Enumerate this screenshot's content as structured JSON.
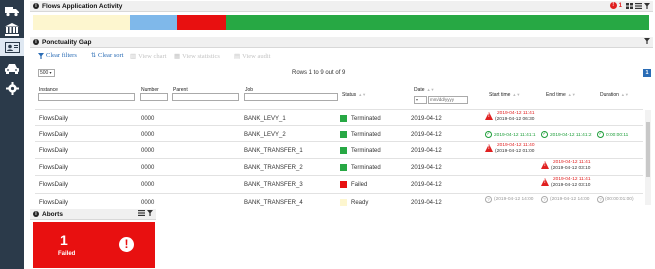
{
  "sidebar": {
    "items": [
      {
        "icon": "truck-icon"
      },
      {
        "icon": "bank-icon"
      },
      {
        "icon": "id-card-icon"
      },
      {
        "icon": "car-icon"
      },
      {
        "icon": "gear-icon"
      }
    ]
  },
  "flows_panel": {
    "title": "Flows Application Activity",
    "alert_count": "1",
    "segments": [
      {
        "color": "#fdf6cf",
        "fraction": 0.158
      },
      {
        "color": "#7fb8ea",
        "fraction": 0.076
      },
      {
        "color": "#e81010",
        "fraction": 0.08
      },
      {
        "color": "#27a844",
        "fraction": 0.686
      }
    ]
  },
  "gap_panel": {
    "title": "Ponctuality Gap",
    "toolbar": {
      "clear_filters": "Clear filters",
      "clear_sort": "Clear sort",
      "view_chart": "View chart",
      "view_statistics": "View statistics",
      "view_audit": "View audit"
    },
    "page_size": "500",
    "rows_info": "Rows 1 to 9 out of 9",
    "page_number": "1",
    "columns": {
      "instance": "Instance",
      "number": "Number",
      "parent": "Parent",
      "job": "Job",
      "status": "Status",
      "date": "Date",
      "start_time": "Start time",
      "end_time": "End time",
      "duration": "Duration"
    },
    "date_placeholder": "mm/dd/yyyy",
    "rows": [
      {
        "instance": "FlowsDaily",
        "number": "0000",
        "job": "BANK_LEVY_1",
        "status": "Terminated",
        "status_color": "#27a844",
        "date": "2019-04-12",
        "start_top": "2019-04-12 11:41",
        "start_bottom": "(2019-04-12 06:30"
      },
      {
        "instance": "FlowsDaily",
        "number": "0000",
        "job": "BANK_LEVY_2",
        "status": "Terminated",
        "status_color": "#27a844",
        "date": "2019-04-12",
        "start": "2019-04-12 11:41:1",
        "end": "2019-04-12 11:41:2",
        "duration": "0:00:00:11"
      },
      {
        "instance": "FlowsDaily",
        "number": "0000",
        "job": "BANK_TRANSFER_1",
        "status": "Terminated",
        "status_color": "#27a844",
        "date": "2019-04-12",
        "start_top": "2019-04-12 11:40",
        "start_bottom": "(2019-04-12 01:00"
      },
      {
        "instance": "FlowsDaily",
        "number": "0000",
        "job": "BANK_TRANSFER_2",
        "status": "Terminated",
        "status_color": "#27a844",
        "date": "2019-04-12",
        "end_top": "2019-04-12 11:41",
        "end_bottom": "(2019-04-12 03:10"
      },
      {
        "instance": "FlowsDaily",
        "number": "0000",
        "job": "BANK_TRANSFER_3",
        "status": "Failed",
        "status_color": "#e81010",
        "date": "2019-04-12",
        "end_top": "2019-04-12 11:41",
        "end_bottom": "(2019-04-12 03:10"
      },
      {
        "instance": "FlowsDaily",
        "number": "0000",
        "job": "BANK_TRANSFER_4",
        "status": "Ready",
        "status_color": "#fdf6cf",
        "date": "2019-04-12",
        "start": "(2019-04-12 14:00",
        "end": "(2019-04-12 14:00",
        "duration": "(00:00:01:00)"
      }
    ]
  },
  "aborts_panel": {
    "title": "Aborts",
    "value": "1",
    "label": "Failed",
    "color": "#e81010"
  }
}
